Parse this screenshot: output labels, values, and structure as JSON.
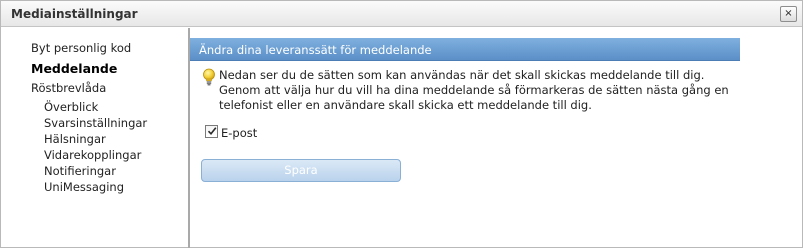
{
  "window": {
    "title": "Mediainställningar",
    "close_label": "×"
  },
  "sidebar": {
    "items": [
      {
        "label": "Byt personlig kod",
        "active": false
      },
      {
        "label": "Meddelande",
        "active": true
      },
      {
        "label": "Röstbrevlåda",
        "active": false
      }
    ],
    "sub_items": [
      {
        "label": "Överblick"
      },
      {
        "label": "Svarsinställningar"
      },
      {
        "label": "Hälsningar"
      },
      {
        "label": "Vidarekopplingar"
      },
      {
        "label": "Notifieringar"
      },
      {
        "label": "UniMessaging"
      }
    ]
  },
  "panel": {
    "header": "Ändra dina leveranssätt för meddelande",
    "info_icon": "lightbulb-icon",
    "info_lines": [
      "Nedan ser du de sätten som kan användas när det skall skickas meddelande till dig.",
      "Genom att välja hur du vill ha dina meddelande så förmarkeras de sätten nästa gång en",
      "telefonist eller en användare skall skicka ett meddelande till dig."
    ],
    "checkbox": {
      "label": "E-post",
      "checked": true
    },
    "save_label": "Spara"
  },
  "colors": {
    "header_bg": "#6a9ed3",
    "button_bg": "#c8dcf0",
    "divider": "#a9a9a9"
  }
}
